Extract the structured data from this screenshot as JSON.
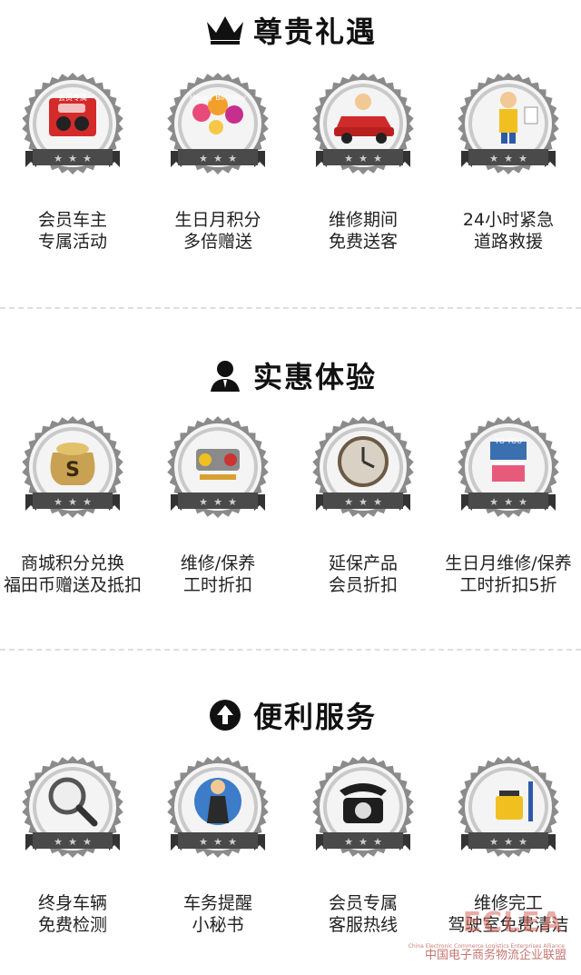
{
  "sections": [
    {
      "title": "尊贵礼遇",
      "icon": "crown-icon",
      "items": [
        {
          "line1": "会员车主",
          "line2": "专属活动",
          "icon": "red-envelope-icon",
          "badge_text": "会员专属"
        },
        {
          "line1": "生日月积分",
          "line2": "多倍赠送",
          "icon": "birthday-balloons-icon",
          "badge_text": "Happy Birthday"
        },
        {
          "line1": "维修期间",
          "line2": "免费送客",
          "icon": "car-service-icon"
        },
        {
          "line1": "24小时紧急",
          "line2": "道路救援",
          "icon": "mechanic-icon"
        }
      ]
    },
    {
      "title": "实惠体验",
      "icon": "agent-icon",
      "items": [
        {
          "line1": "商城积分兑换",
          "line2": "福田币赠送及抵扣",
          "icon": "money-bag-icon"
        },
        {
          "line1": "维修/保养",
          "line2": "工时折扣",
          "icon": "engine-parts-icon"
        },
        {
          "line1": "延保产品",
          "line2": "会员折扣",
          "icon": "clock-icon"
        },
        {
          "line1": "生日月维修/保养",
          "line2": "工时折扣5折",
          "icon": "birthday-cake-icon",
          "badge_text": "TO YOU"
        }
      ]
    },
    {
      "title": "便利服务",
      "icon": "upload-arrow-icon",
      "items": [
        {
          "line1": "终身车辆",
          "line2": "免费检测",
          "icon": "magnifier-icon"
        },
        {
          "line1": "车务提醒",
          "line2": "小秘书",
          "icon": "secretary-icon"
        },
        {
          "line1": "会员专属",
          "line2": "客服热线",
          "icon": "telephone-icon"
        },
        {
          "line1": "维修完工",
          "line2": "驾驶室免费清洁",
          "icon": "cleaning-kit-icon"
        }
      ]
    }
  ],
  "watermark": {
    "logo": "ECLEA",
    "en": "China Electronic Commerce Logistics Enterprises Alliance",
    "cn": "中国电子商务物流企业联盟"
  },
  "colors": {
    "badge_dark": "#4a4a4a",
    "badge_ring": "#8b8b8b",
    "badge_face": "#c9c9c9",
    "divider": "#dedede"
  }
}
